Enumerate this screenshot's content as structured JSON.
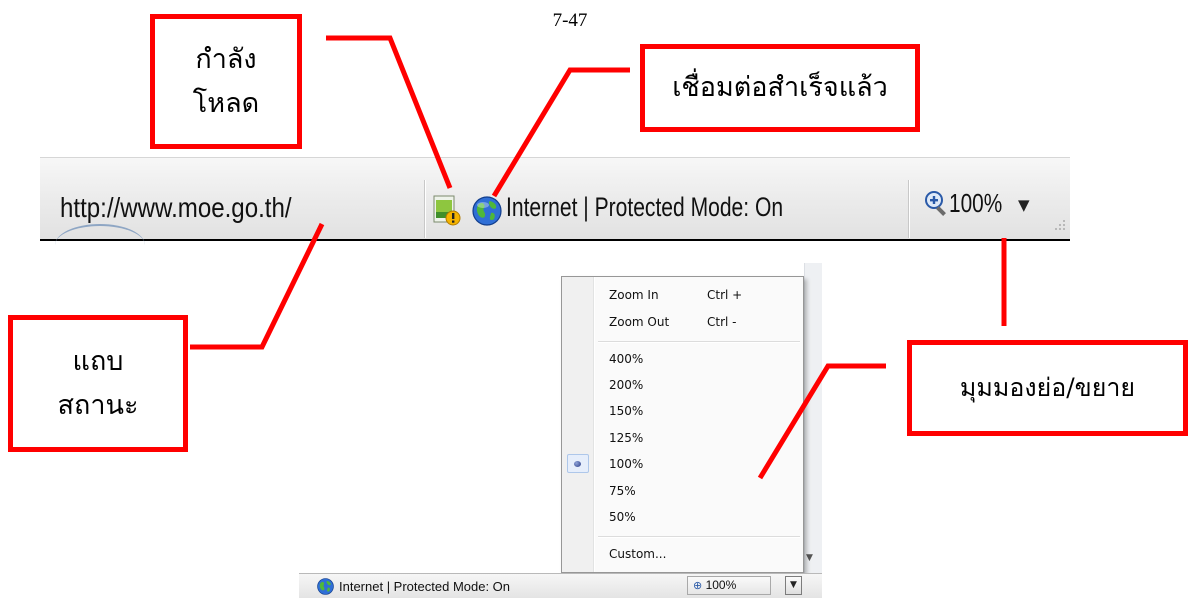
{
  "page_number": "7-47",
  "callouts": {
    "loading": "กำลัง\nโหลด",
    "connected": "เชื่อมต่อสำเร็จแล้ว",
    "status_bar": "แถบ\nสถานะ",
    "zoom": "มุมมองย่อ/ขยาย"
  },
  "status_bar_large": {
    "url": "http://www.moe.go.th/",
    "zone_text": "Internet | Protected Mode: On",
    "zoom_level": "100%"
  },
  "status_bar_small": {
    "zone_text": "Internet | Protected Mode: On",
    "zoom_level": "100%"
  },
  "zoom_menu": {
    "zoom_in": {
      "label": "Zoom In",
      "shortcut": "Ctrl +"
    },
    "zoom_out": {
      "label": "Zoom Out",
      "shortcut": "Ctrl -"
    },
    "levels": [
      "400%",
      "200%",
      "150%",
      "125%",
      "100%",
      "75%",
      "50%"
    ],
    "selected_level": "100%",
    "custom": "Custom..."
  },
  "colors": {
    "callout_red": "#ff0000",
    "menu_check": "#2a3c86"
  }
}
